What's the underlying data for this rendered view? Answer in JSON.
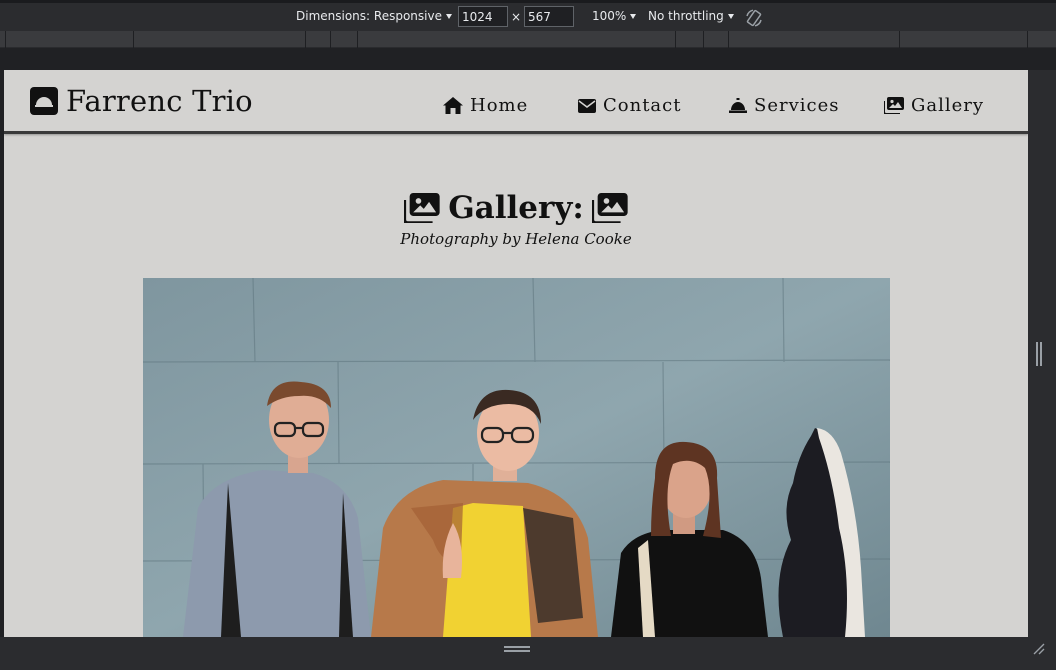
{
  "devtools": {
    "dimensions_label": "Dimensions: Responsive",
    "width_value": "1024",
    "times_symbol": "×",
    "height_value": "567",
    "zoom_label": "100%",
    "throttle_label": "No throttling",
    "rotate_icon": "rotate-icon"
  },
  "site": {
    "brand": "Farrenc Trio",
    "brand_icon": "service-bell-icon",
    "nav": [
      {
        "label": "Home",
        "icon": "home-icon"
      },
      {
        "label": "Contact",
        "icon": "envelope-icon"
      },
      {
        "label": "Services",
        "icon": "service-bell-icon"
      },
      {
        "label": "Gallery",
        "icon": "images-icon"
      }
    ]
  },
  "gallery": {
    "title": "Gallery:",
    "subtitle": "Photography by Helena Cooke",
    "icon": "images-icon",
    "photo_subject": "three-musicians-photo"
  },
  "colors": {
    "page_bg": "#d4d3d1",
    "text": "#111111",
    "devtools_bg": "#202124"
  }
}
